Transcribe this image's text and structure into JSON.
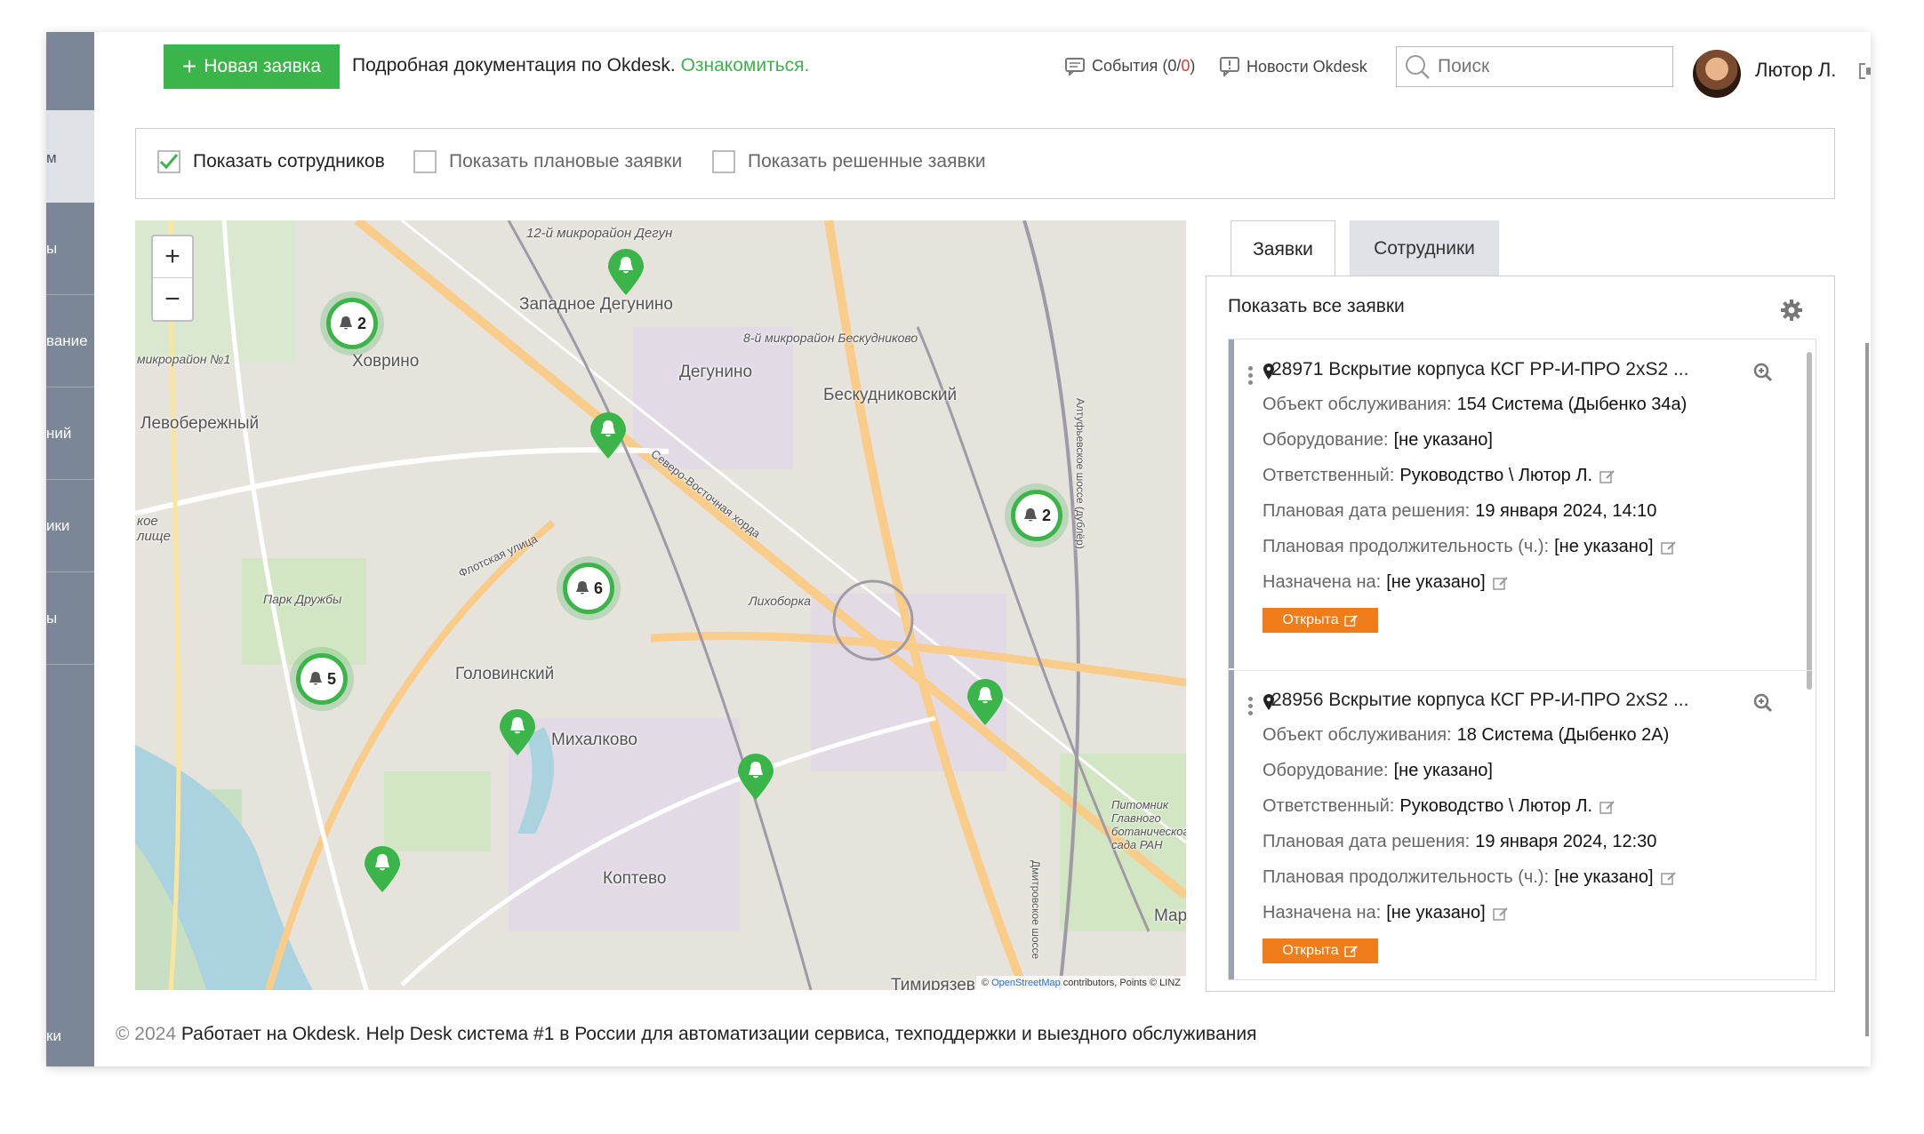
{
  "header": {
    "new_button": "Новая заявка",
    "doc_text": "Подробная документация по Okdesk.",
    "doc_link": "Ознакомиться.",
    "events": "События",
    "events_count_a": "(0/",
    "events_count_b": "0",
    "events_count_c": ")",
    "news": "Новости Okdesk",
    "search_placeholder": "Поиск",
    "user_name": "Лютор Л."
  },
  "sidebar": {
    "items": [
      "м",
      "ы",
      "вание",
      "ний",
      "ики",
      "ы",
      "ки"
    ]
  },
  "filters": {
    "show_staff": "Показать сотрудников",
    "show_planned": "Показать плановые заявки",
    "show_resolved": "Показать решенные заявки",
    "show_staff_checked": true
  },
  "map": {
    "labels": [
      "12-й микрорайон Дегун",
      "Западное Дегунино",
      "Ховрино",
      "микрорайон №1",
      "Левобережный",
      "Дегунино",
      "8-й микрорайон Бескудниково",
      "Бескудниковский",
      "Северо-Восточная хорда",
      "Флотская улица",
      "Лихоборка",
      "Парк Дружбы",
      "Головинский",
      "Михалково",
      "Коптево",
      "Питомник Главного ботанического сада РАН",
      "Алтуфьевское шоссе (дублёр)",
      "Дмитровское шоссе",
      "Мар",
      "Тимирязев",
      "кое лище"
    ],
    "clusters": [
      "2",
      "2",
      "6",
      "5"
    ],
    "attribution_prefix": "©",
    "attribution_link": "OpenStreetMap",
    "attribution_rest": "contributors, Points © LINZ",
    "zoom_in": "+",
    "zoom_out": "−"
  },
  "panel": {
    "tab_requests": "Заявки",
    "tab_staff": "Сотрудники",
    "show_all": "Показать все заявки",
    "cards": [
      {
        "title": "28971 Вскрытие корпуса КСГ РР-И-ПРО 2xS2 ...",
        "object_label": "Объект обслуживания:",
        "object": "154 Система (Дыбенко 34а)",
        "equipment_label": "Оборудование:",
        "equipment": "[не указано]",
        "responsible_label": "Ответственный:",
        "responsible": "Руководство \\ Лютор Л.",
        "due_label": "Плановая дата решения:",
        "due": "19 января 2024, 14:10",
        "duration_label": "Плановая продолжительность (ч.):",
        "duration": "[не указано]",
        "assigned_label": "Назначена на:",
        "assigned": "[не указано]",
        "status": "Открыта"
      },
      {
        "title": "28956 Вскрытие корпуса КСГ РР-И-ПРО 2xS2 ...",
        "object_label": "Объект обслуживания:",
        "object": "18 Система (Дыбенко 2А)",
        "equipment_label": "Оборудование:",
        "equipment": "[не указано]",
        "responsible_label": "Ответственный:",
        "responsible": "Руководство \\ Лютор Л.",
        "due_label": "Плановая дата решения:",
        "due": "19 января 2024, 12:30",
        "duration_label": "Плановая продолжительность (ч.):",
        "duration": "[не указано]",
        "assigned_label": "Назначена на:",
        "assigned": "[не указано]",
        "status": "Открыта"
      }
    ]
  },
  "footer": {
    "year": "© 2024",
    "text": "Работает на Okdesk. Help Desk система #1 в России для автоматизации сервиса, техподдержки и выездного обслуживания"
  },
  "colors": {
    "accent_green": "#3bb54a",
    "status_orange": "#f07d1a",
    "sidebar": "#7b8797"
  }
}
